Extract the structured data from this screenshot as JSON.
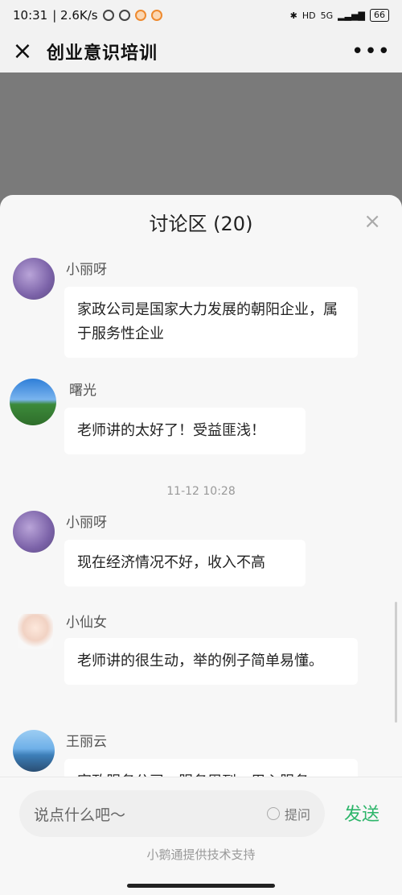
{
  "statusbar": {
    "time": "10:31",
    "speed": "| 2.6K/s",
    "network": "5G",
    "battery": "66"
  },
  "topbar": {
    "close_icon": "×",
    "title": "创业意识培训",
    "more_icon": "•••"
  },
  "sheet": {
    "title": "讨论区 (20)",
    "close_icon": "×"
  },
  "messages": [
    {
      "name": "小丽呀",
      "text": "家政公司是国家大力发展的朝阳企业，属于服务性企业"
    },
    {
      "name": "曙光",
      "text": "老师讲的太好了！受益匪浅！"
    },
    {
      "name": "小丽呀",
      "text": "现在经济情况不好，收入不高"
    },
    {
      "name": "小仙女",
      "text": "老师讲的很生动，举的例子简单易懂。"
    },
    {
      "name": "王丽云",
      "text": "家政服务公司，服务周到，用心服务"
    }
  ],
  "timestamp": "11-12 10:28",
  "input": {
    "placeholder": "说点什么吧～",
    "ask_label": "提问",
    "send_label": "发送"
  },
  "footer": "小鹅通提供技术支持"
}
